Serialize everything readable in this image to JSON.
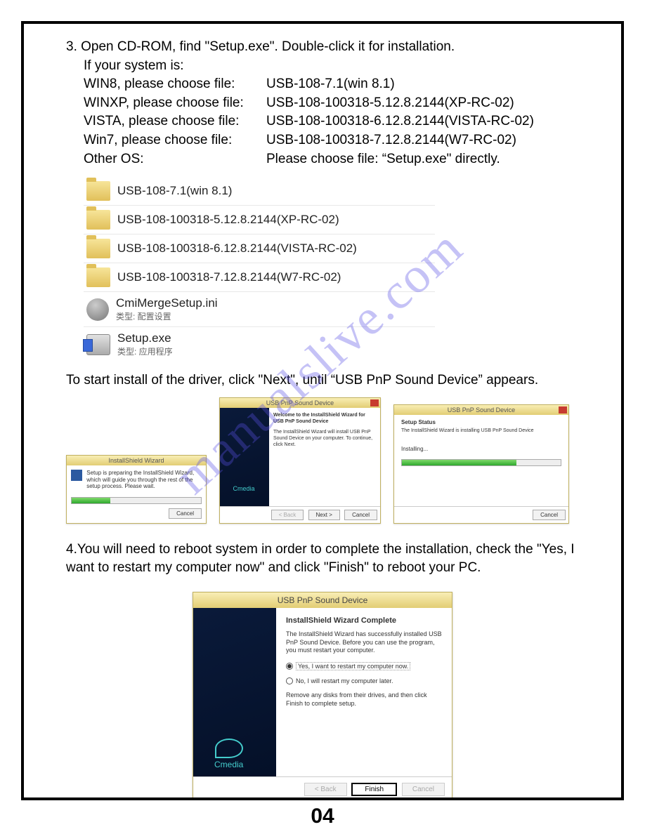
{
  "watermark": "manualslive.com",
  "step3": {
    "line1": "3. Open CD-ROM, find \"Setup.exe\". Double-click it for installation.",
    "line2": "If your system is:",
    "rows": [
      {
        "os": "WIN8, please choose file:",
        "file": "USB-108-7.1(win 8.1)"
      },
      {
        "os": "WINXP, please choose file:",
        "file": "USB-108-100318-5.12.8.2144(XP-RC-02)"
      },
      {
        "os": "VISTA, please choose file:",
        "file": "USB-108-100318-6.12.8.2144(VISTA-RC-02)"
      },
      {
        "os": "Win7, please choose file:",
        "file": "USB-108-100318-7.12.8.2144(W7-RC-02)"
      },
      {
        "os": "Other OS:",
        "file": "Please choose file: “Setup.exe\" directly."
      }
    ]
  },
  "files": {
    "folders": [
      "USB-108-7.1(win 8.1)",
      "USB-108-100318-5.12.8.2144(XP-RC-02)",
      "USB-108-100318-6.12.8.2144(VISTA-RC-02)",
      "USB-108-100318-7.12.8.2144(W7-RC-02)"
    ],
    "ini": {
      "name": "CmiMergeSetup.ini",
      "meta": "类型: 配置设置"
    },
    "exe": {
      "name": "Setup.exe",
      "meta": "类型: 应用程序"
    }
  },
  "start_text": "To start install of the driver, click \"Next\", until “USB PnP Sound Device” appears.",
  "win1": {
    "title": "InstallShield Wizard",
    "msg": "Setup is preparing the InstallShield Wizard, which will guide you through the rest of the setup process. Please wait.",
    "cancel": "Cancel"
  },
  "win2": {
    "title": "USB PnP Sound Device",
    "heading": "Welcome to the InstallShield Wizard for USB PnP Sound Device",
    "body": "The InstallShield Wizard will install USB PnP Sound Device on your computer. To continue, click Next.",
    "back": "< Back",
    "next": "Next >",
    "cancel": "Cancel",
    "logo": "Cmedia"
  },
  "win3": {
    "title": "USB PnP Sound Device",
    "section": "Setup Status",
    "text": "The InstallShield Wizard is installing USB PnP Sound Device",
    "status_label": "Installing...",
    "cancel": "Cancel"
  },
  "step4_text": "4.You will need to reboot system in order to complete the installation, check the \"Yes, I want to restart my computer now\" and click \"Finish\" to reboot your PC.",
  "win4": {
    "title": "USB PnP Sound Device",
    "heading": "InstallShield Wizard Complete",
    "para": "The InstallShield Wizard has successfully installed USB PnP Sound Device. Before you can use the program, you must restart your computer.",
    "opt_yes": "Yes, I want to restart my computer now.",
    "opt_no": "No, I will restart my computer later.",
    "remove": "Remove any disks from their drives, and then click Finish to complete setup.",
    "back": "< Back",
    "finish": "Finish",
    "cancel": "Cancel",
    "logo": "Cmedia"
  },
  "page_number": "04"
}
